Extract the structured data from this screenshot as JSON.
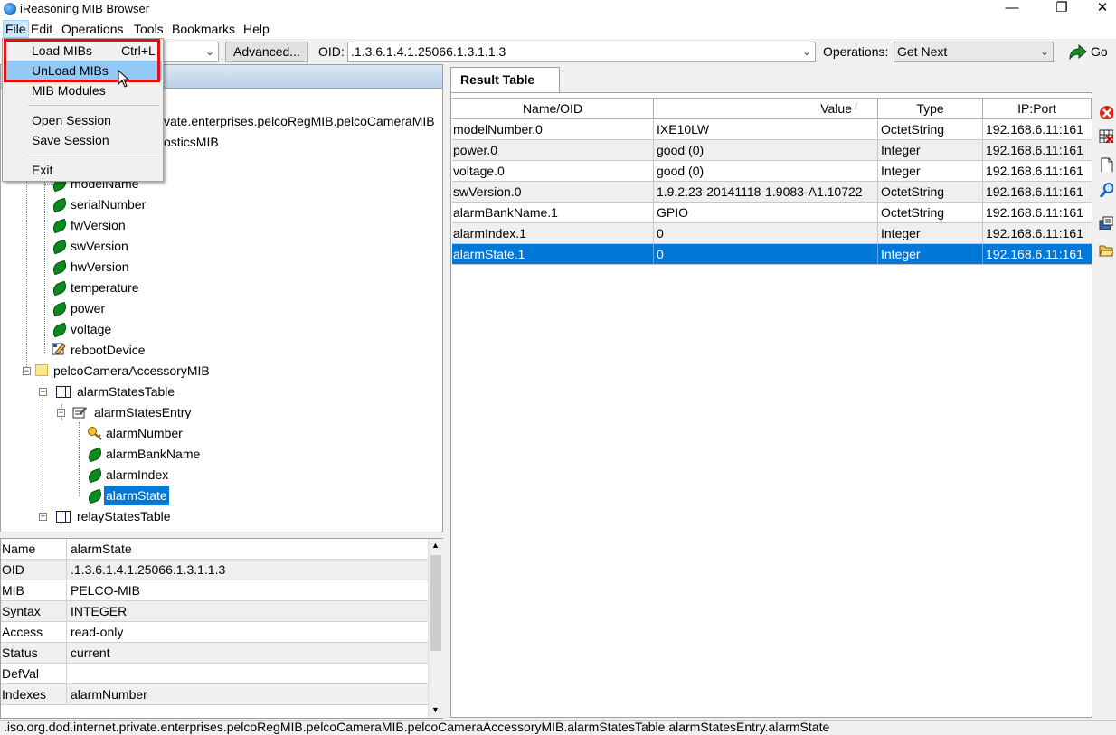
{
  "window": {
    "title": "iReasoning MIB Browser",
    "minimize": "—",
    "maximize": "❐",
    "close": "✕"
  },
  "menubar": [
    "File",
    "Edit",
    "Operations",
    "Tools",
    "Bookmarks",
    "Help"
  ],
  "toolbar": {
    "advanced_label": "Advanced...",
    "oid_label": "OID:",
    "oid_value": ".1.3.6.1.4.1.25066.1.3.1.1.3",
    "operations_label": "Operations:",
    "operations_value": "Get Next",
    "go_label": "Go"
  },
  "file_menu": {
    "load_mibs": "Load MIBs",
    "load_mibs_shortcut": "Ctrl+L",
    "unload_mibs": "UnLoad MIBs",
    "mib_modules": "MIB Modules",
    "open_session": "Open Session",
    "save_session": "Save Session",
    "exit": "Exit"
  },
  "tree": {
    "partial_path": "vate.enterprises.pelcoRegMIB.pelcoCameraMIB",
    "partial_diag": "osticsMIB",
    "leaves": [
      "modelName",
      "serialNumber",
      "fwVersion",
      "swVersion",
      "hwVersion",
      "temperature",
      "power",
      "voltage"
    ],
    "reboot": "rebootDevice",
    "accessory_mib": "pelcoCameraAccessoryMIB",
    "alarm_table": "alarmStatesTable",
    "alarm_entry": "alarmStatesEntry",
    "alarm_number": "alarmNumber",
    "alarm_bank": "alarmBankName",
    "alarm_index": "alarmIndex",
    "alarm_state": "alarmState",
    "relay_table": "relayStatesTable"
  },
  "properties": [
    {
      "key": "Name",
      "value": "alarmState"
    },
    {
      "key": "OID",
      "value": ".1.3.6.1.4.1.25066.1.3.1.1.3"
    },
    {
      "key": "MIB",
      "value": "PELCO-MIB"
    },
    {
      "key": "Syntax",
      "value": "INTEGER"
    },
    {
      "key": "Access",
      "value": "read-only"
    },
    {
      "key": "Status",
      "value": "current"
    },
    {
      "key": "DefVal",
      "value": ""
    },
    {
      "key": "Indexes",
      "value": "alarmNumber"
    }
  ],
  "result": {
    "tab_label": "Result Table",
    "headers": {
      "name": "Name/OID",
      "value": "Value",
      "type": "Type",
      "ip": "IP:Port"
    },
    "rows": [
      {
        "name": "modelNumber.0",
        "value": "IXE10LW",
        "type": "OctetString",
        "ip": "192.168.6.11:161"
      },
      {
        "name": "power.0",
        "value": "good (0)",
        "type": "Integer",
        "ip": "192.168.6.11:161"
      },
      {
        "name": "voltage.0",
        "value": "good (0)",
        "type": "Integer",
        "ip": "192.168.6.11:161"
      },
      {
        "name": "swVersion.0",
        "value": "1.9.2.23-20141118-1.9083-A1.10722",
        "type": "OctetString",
        "ip": "192.168.6.11:161"
      },
      {
        "name": "alarmBankName.1",
        "value": "GPIO",
        "type": "OctetString",
        "ip": "192.168.6.11:161"
      },
      {
        "name": "alarmIndex.1",
        "value": "0",
        "type": "Integer",
        "ip": "192.168.6.11:161"
      },
      {
        "name": "alarmState.1",
        "value": "0",
        "type": "Integer",
        "ip": "192.168.6.11:161"
      }
    ]
  },
  "status_path": ".iso.org.dod.internet.private.enterprises.pelcoRegMIB.pelcoCameraMIB.pelcoCameraAccessoryMIB.alarmStatesTable.alarmStatesEntry.alarmState",
  "colors": {
    "selection": "#0078d7",
    "highlight_box": "#e01010",
    "leaf_green": "#0b8a1e"
  }
}
